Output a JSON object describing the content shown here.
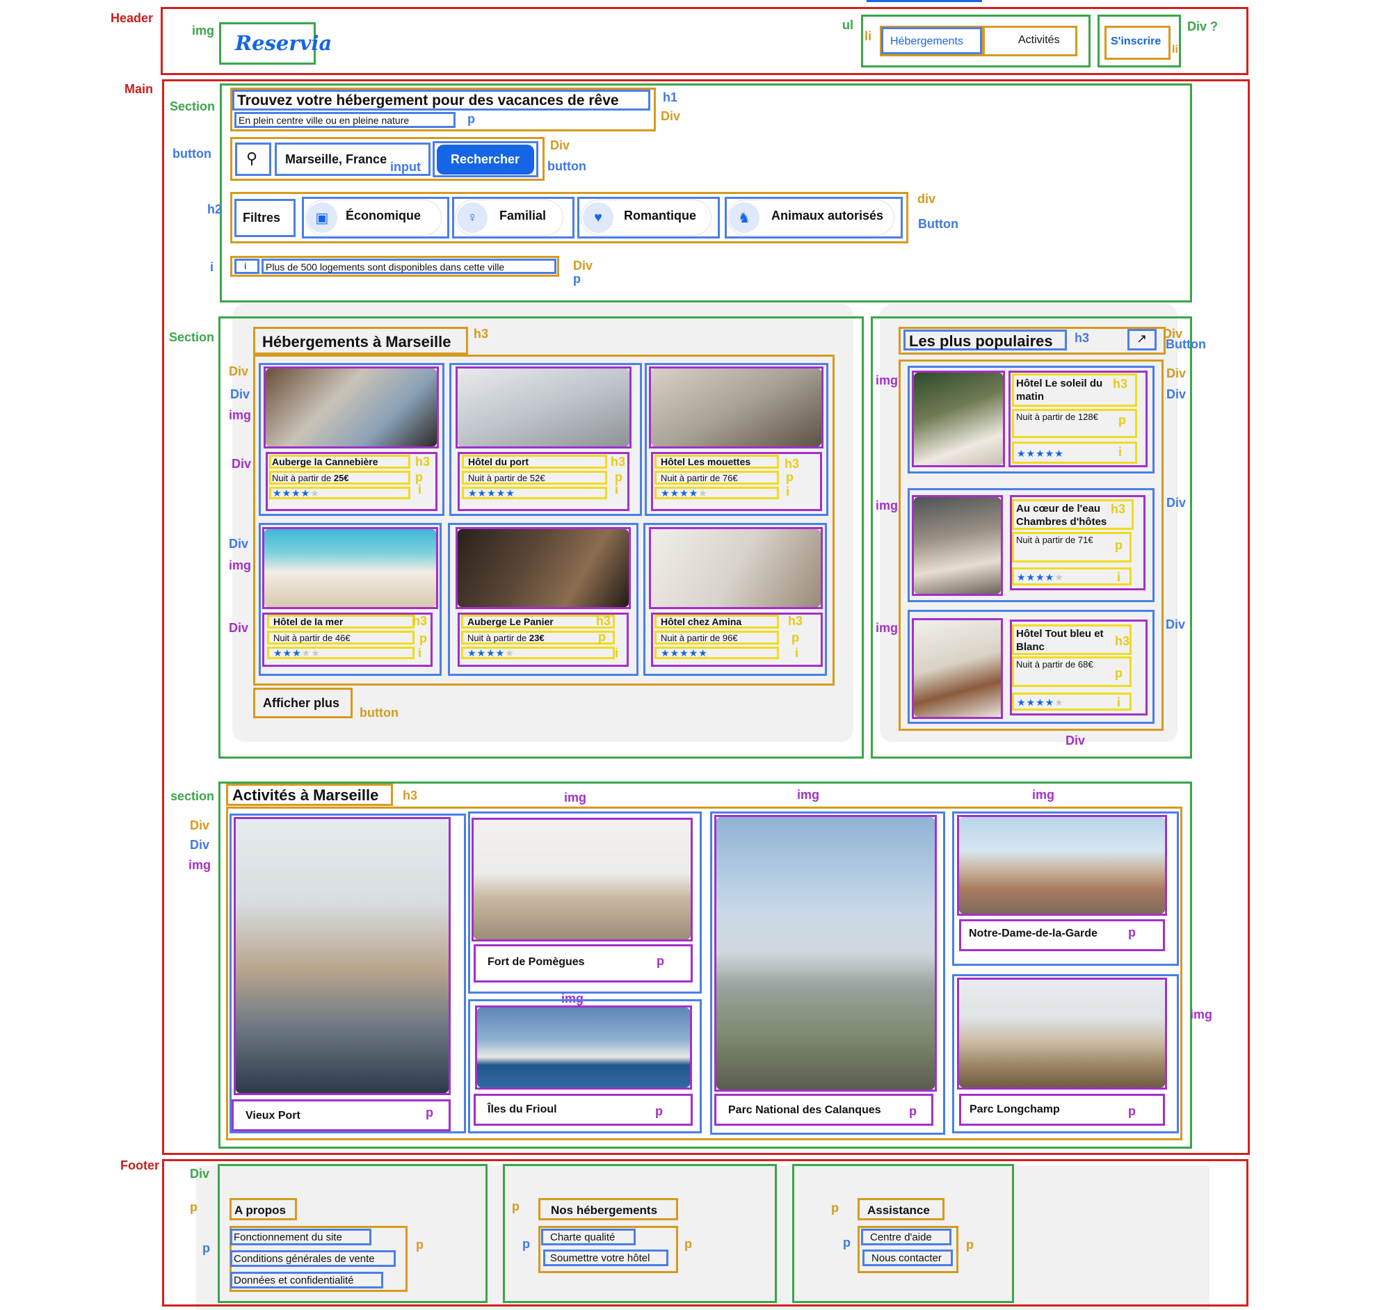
{
  "region_labels": {
    "header": "Header",
    "main": "Main",
    "footer": "Footer",
    "div_question": "Div ?"
  },
  "element_labels": {
    "img": "img",
    "ul": "ul",
    "li": "li",
    "section": "Section",
    "section_lower": "section",
    "button": "button",
    "button_cap": "Button",
    "button_cap2": "Button",
    "h1": "h1",
    "h2": "h2",
    "h3": "h3",
    "div": "Div",
    "div_lower": "div",
    "p": "p",
    "i": "i",
    "input": "input"
  },
  "header": {
    "logo": "Reservia",
    "nav": [
      "Hébergements",
      "Activités"
    ],
    "signup": "S'inscrire"
  },
  "hero": {
    "title": "Trouvez votre hébergement pour des vacances de rêve",
    "subtitle": "En plein centre ville ou en pleine nature",
    "search_value": "Marseille, France",
    "search_button": "Rechercher",
    "filters_label": "Filtres",
    "filters": [
      "Économique",
      "Familial",
      "Romantique",
      "Animaux autorisés"
    ],
    "info": "Plus de 500 logements sont disponibles dans cette ville"
  },
  "lodgings": {
    "title": "Hébergements à Marseille",
    "more_button": "Afficher plus",
    "cards": [
      {
        "name": "Auberge la Cannebière",
        "price_prefix": "Nuit à partir de ",
        "price": "25€",
        "rating": 4
      },
      {
        "name": "Hôtel du port",
        "price_prefix": "Nuit à partir de ",
        "price": "52€",
        "rating": 5
      },
      {
        "name": "Hôtel Les mouettes",
        "price_prefix": "Nuit à partir de ",
        "price": "76€",
        "rating": 4
      },
      {
        "name": "Hôtel de la mer",
        "price_prefix": "Nuit à partir de ",
        "price": "46€",
        "rating": 3
      },
      {
        "name": "Auberge Le Panier",
        "price_prefix": "Nuit à partir de ",
        "price": "23€",
        "rating": 4
      },
      {
        "name": "Hôtel chez Amina",
        "price_prefix": "Nuit à partir de ",
        "price": "96€",
        "rating": 5
      }
    ]
  },
  "popular": {
    "title": "Les plus populaires",
    "items": [
      {
        "name": "Hôtel Le soleil du matin",
        "price": "Nuit à partir de 128€",
        "rating": 5
      },
      {
        "name": "Au cœur de l'eau Chambres d'hôtes",
        "price": "Nuit à partir de 71€",
        "rating": 4
      },
      {
        "name": "Hôtel Tout bleu et Blanc",
        "price": "Nuit à partir de 68€",
        "rating": 4
      }
    ]
  },
  "activities": {
    "title": "Activités à Marseille",
    "items": [
      "Vieux Port",
      "Fort de Pomègues",
      "Îles du Frioul",
      "Parc National des Calanques",
      "Notre-Dame-de-la-Garde",
      "Parc Longchamp"
    ]
  },
  "footer": {
    "columns": [
      {
        "title": "A propos",
        "links": [
          "Fonctionnement du site",
          "Conditions générales de vente",
          "Données et confidentialité"
        ]
      },
      {
        "title": "Nos hébergements",
        "links": [
          "Charte qualité",
          "Soumettre votre hôtel"
        ]
      },
      {
        "title": "Assistance",
        "links": [
          "Centre d'aide",
          "Nous contacter"
        ]
      }
    ]
  },
  "colors": {
    "accent": "#1565e6",
    "gray_bg": "#f1f1f1"
  }
}
